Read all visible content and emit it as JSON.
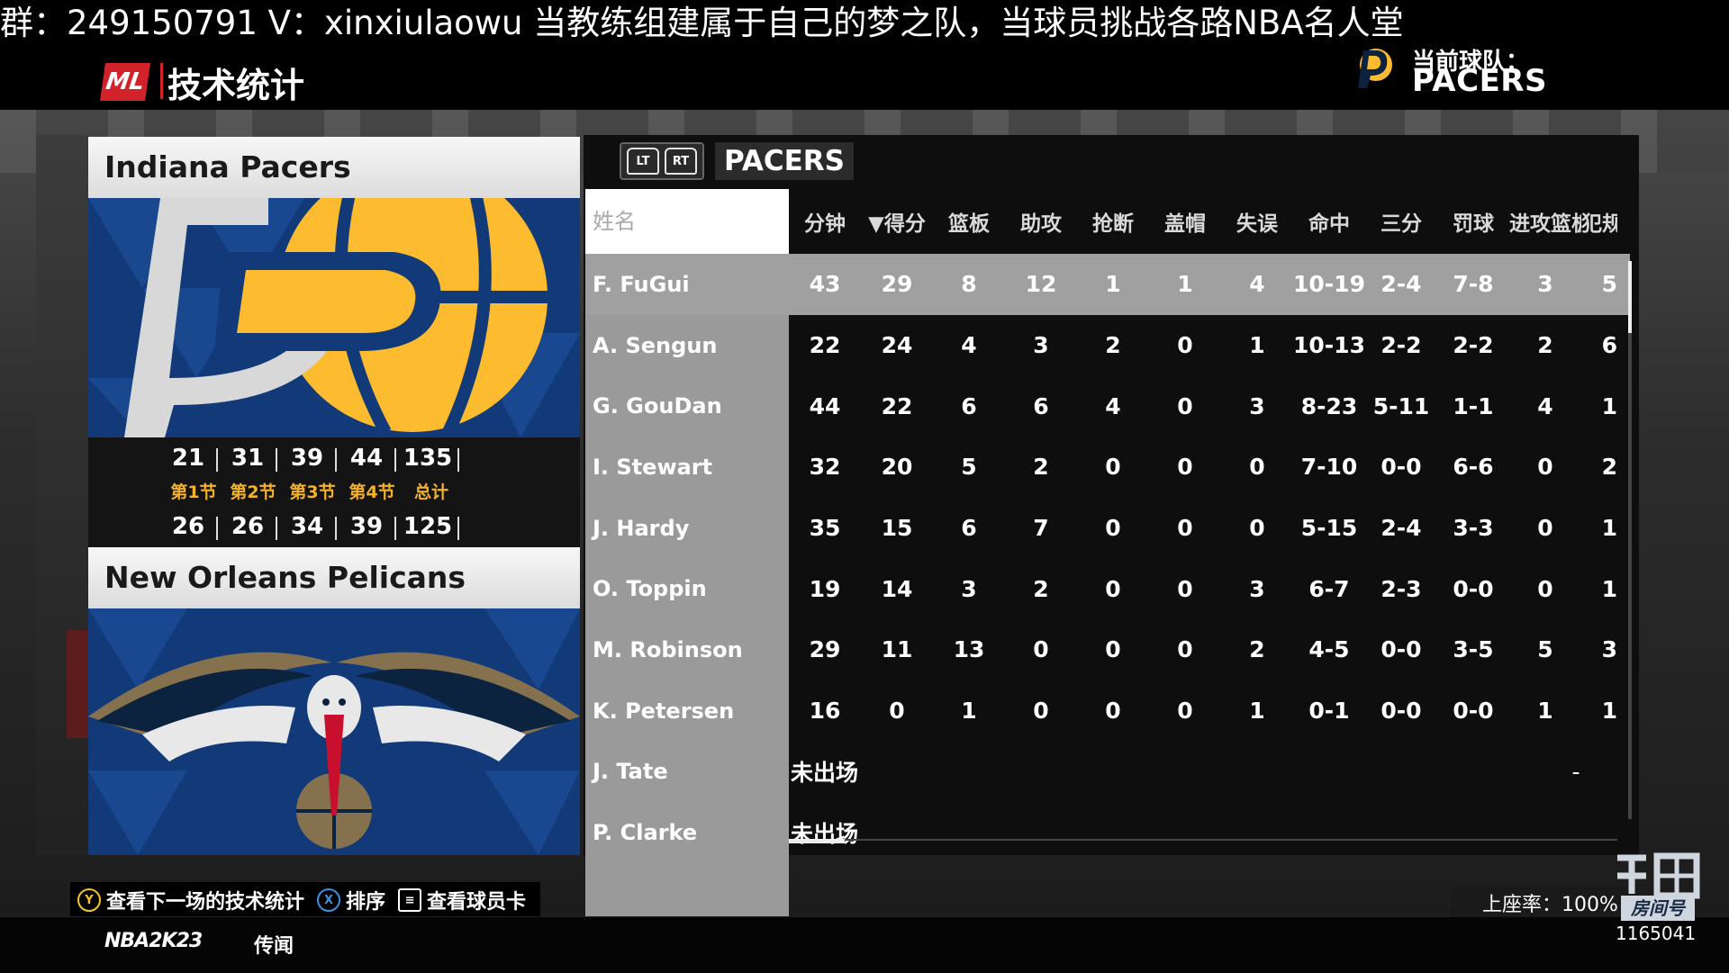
{
  "stream": {
    "marquee": "群：249150791 V：xinxiulaowu  当教练组建属于自己的梦之队，当球员挑战各路NBA名人堂",
    "watermark": {
      "rate": "上座率：100%",
      "room_label": "房间号",
      "room_id": "1165041"
    }
  },
  "header": {
    "logo": "ML",
    "title": "技术统计",
    "current_team_label": "当前球队：",
    "current_team_name": "PACERS"
  },
  "home_team": {
    "name": "Indiana Pacers",
    "quarters": [
      "21",
      "31",
      "39",
      "44"
    ],
    "total": "135",
    "colors": {
      "primary": "#0c2340",
      "accent": "#fdbb30"
    }
  },
  "quarter_labels": [
    "第1节",
    "第2节",
    "第3节",
    "第4节",
    "总计"
  ],
  "away_team": {
    "name": "New Orleans Pelicans",
    "quarters": [
      "26",
      "26",
      "34",
      "39"
    ],
    "total": "125",
    "colors": {
      "primary": "#0c2340",
      "accent": "#c8102e",
      "gold": "#85714d"
    }
  },
  "stats": {
    "tab_buttons": [
      "LT",
      "RT"
    ],
    "team_tab": "PACERS",
    "name_header": "姓名",
    "columns": [
      "分钟",
      "▼得分",
      "篮板",
      "助攻",
      "抢断",
      "盖帽",
      "失误",
      "命中",
      "三分",
      "罚球",
      "进攻篮板",
      "犯规"
    ],
    "players": [
      {
        "name": "F. FuGui",
        "values": [
          "43",
          "29",
          "8",
          "12",
          "1",
          "1",
          "4",
          "10-19",
          "2-4",
          "7-8",
          "3",
          "5"
        ],
        "selected": true
      },
      {
        "name": "A. Sengun",
        "values": [
          "22",
          "24",
          "4",
          "3",
          "2",
          "0",
          "1",
          "10-13",
          "2-2",
          "2-2",
          "2",
          "6"
        ]
      },
      {
        "name": "G. GouDan",
        "values": [
          "44",
          "22",
          "6",
          "6",
          "4",
          "0",
          "3",
          "8-23",
          "5-11",
          "1-1",
          "4",
          "1"
        ]
      },
      {
        "name": "I. Stewart",
        "values": [
          "32",
          "20",
          "5",
          "2",
          "0",
          "0",
          "0",
          "7-10",
          "0-0",
          "6-6",
          "0",
          "2"
        ]
      },
      {
        "name": "J. Hardy",
        "values": [
          "35",
          "15",
          "6",
          "7",
          "0",
          "0",
          "0",
          "5-15",
          "2-4",
          "3-3",
          "0",
          "1"
        ]
      },
      {
        "name": "O. Toppin",
        "values": [
          "19",
          "14",
          "3",
          "2",
          "0",
          "0",
          "3",
          "6-7",
          "2-3",
          "0-0",
          "0",
          "1"
        ]
      },
      {
        "name": "M. Robinson",
        "values": [
          "29",
          "11",
          "13",
          "0",
          "0",
          "0",
          "2",
          "4-5",
          "0-0",
          "3-5",
          "5",
          "3"
        ]
      },
      {
        "name": "K. Petersen",
        "values": [
          "16",
          "0",
          "1",
          "0",
          "0",
          "0",
          "1",
          "0-1",
          "0-0",
          "0-0",
          "1",
          "1"
        ]
      },
      {
        "name": "J. Tate",
        "dnp": "未出场",
        "dashes": [
          "-",
          "-",
          "-"
        ]
      },
      {
        "name": "P. Clarke",
        "dnp": "未出场"
      }
    ]
  },
  "hints": [
    {
      "button": "Y",
      "color": "#f3c623",
      "label": "查看下一场的技术统计"
    },
    {
      "button": "X",
      "color": "#3d8fe0",
      "label": "排序"
    },
    {
      "button": "≡",
      "color": "#ffffff",
      "label": "查看球员卡"
    }
  ],
  "footer": {
    "game_logo": "NBA2K23",
    "rumor_label": "传闻"
  }
}
